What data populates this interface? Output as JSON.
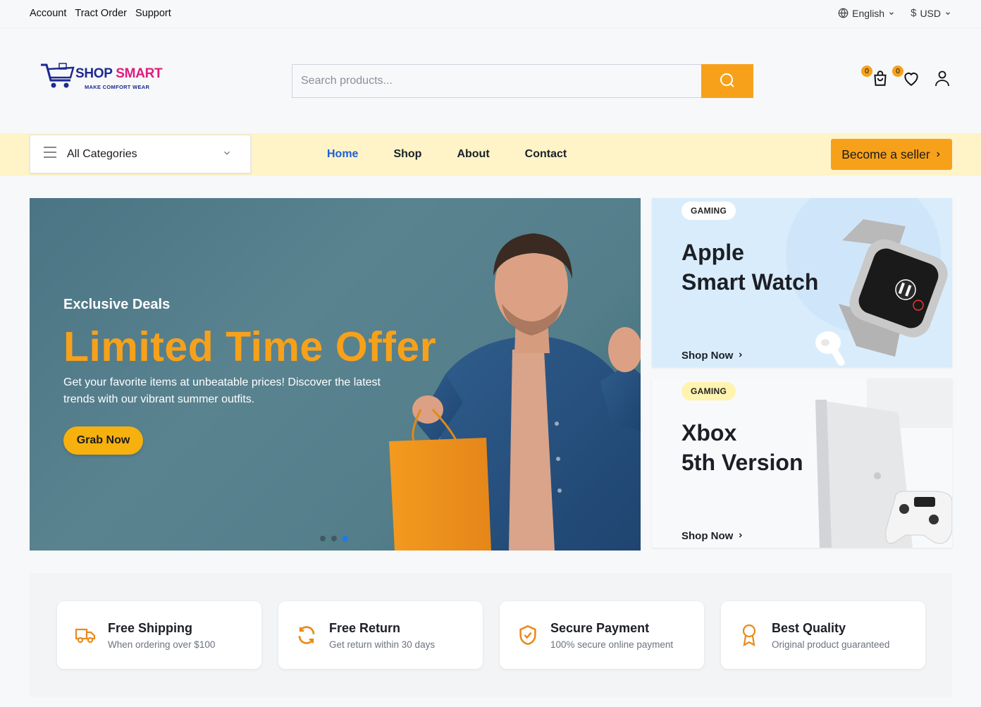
{
  "topbar": {
    "links": [
      "Account",
      "Tract Order",
      "Support"
    ],
    "language": "English",
    "currency": "USD"
  },
  "logo": {
    "brand_part1": "SHOP",
    "brand_part2": "SMART",
    "tagline": "MAKE COMFORT WEAR"
  },
  "search": {
    "placeholder": "Search products...",
    "value": ""
  },
  "header_icons": {
    "cart_count": "0",
    "wishlist_count": "0"
  },
  "nav": {
    "categories_label": "All Categories",
    "links": [
      "Home",
      "Shop",
      "About",
      "Contact"
    ],
    "active": "Home",
    "seller_button": "Become a seller"
  },
  "hero": {
    "kicker": "Exclusive Deals",
    "title": "Limited Time Offer",
    "description": "Get your favorite items at unbeatable prices! Discover the latest trends with our vibrant summer outfits.",
    "button": "Grab Now",
    "slides": 3,
    "active_slide": 3
  },
  "promo_cards": [
    {
      "tag": "GAMING",
      "title_line1": "Apple",
      "title_line2": "Smart Watch",
      "cta": "Shop Now"
    },
    {
      "tag": "GAMING",
      "title_line1": "Xbox",
      "title_line2": "5th Version",
      "cta": "Shop Now"
    }
  ],
  "features": [
    {
      "title": "Free Shipping",
      "subtitle": "When ordering over $100",
      "icon": "truck-icon"
    },
    {
      "title": "Free Return",
      "subtitle": "Get return within 30 days",
      "icon": "refresh-icon"
    },
    {
      "title": "Secure Payment",
      "subtitle": "100% secure online payment",
      "icon": "shield-check-icon"
    },
    {
      "title": "Best Quality",
      "subtitle": "Original product guaranteed",
      "icon": "award-icon"
    }
  ],
  "colors": {
    "accent": "#f7a11a",
    "nav_bg": "#fff3c8",
    "active_link": "#1a5fd6",
    "hero_bg": "#4b7484",
    "card1_bg": "#d9ecfb"
  }
}
